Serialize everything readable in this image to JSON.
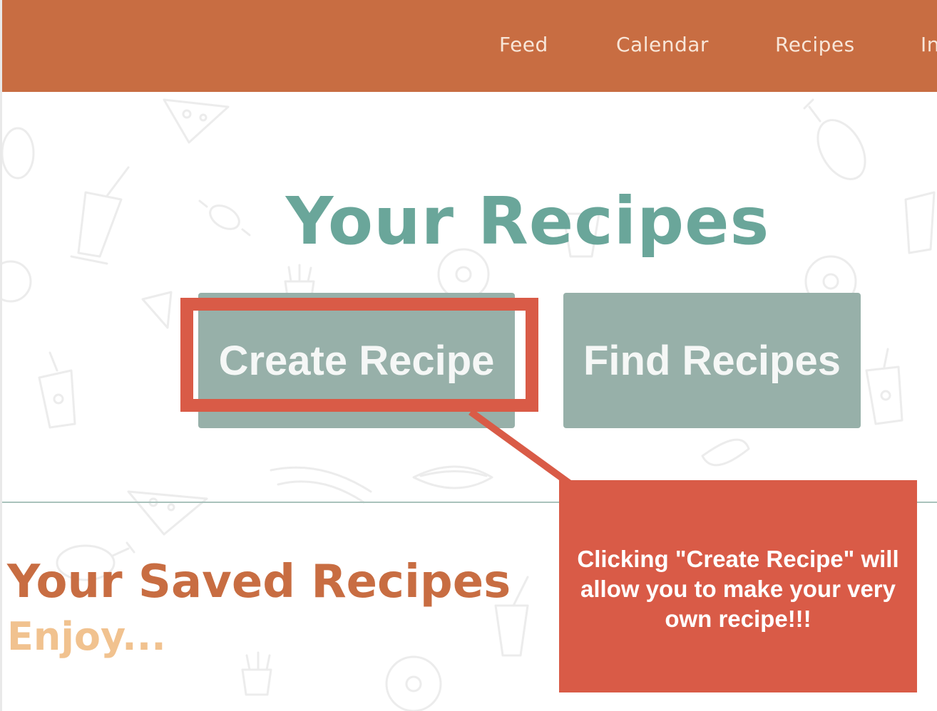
{
  "nav": {
    "items": [
      {
        "label": "Feed"
      },
      {
        "label": "Calendar"
      },
      {
        "label": "Recipes"
      },
      {
        "label": "In"
      }
    ]
  },
  "main": {
    "title": "Your Recipes",
    "create_button_label": "Create Recipe",
    "find_button_label": "Find Recipes"
  },
  "saved": {
    "title": "Your Saved Recipes",
    "subtitle": "Enjoy..."
  },
  "annotation": {
    "text": "Clicking \"Create Recipe\" will allow you to make your very own recipe!!!"
  },
  "colors": {
    "nav_bg": "#c86d42",
    "title": "#6aa69a",
    "button_bg": "#97b0a9",
    "saved_title": "#c86d42",
    "saved_subtitle": "#f1c28f",
    "annotation": "#d95b47"
  },
  "icons": {
    "background_pattern": "food-doodle-pattern"
  }
}
